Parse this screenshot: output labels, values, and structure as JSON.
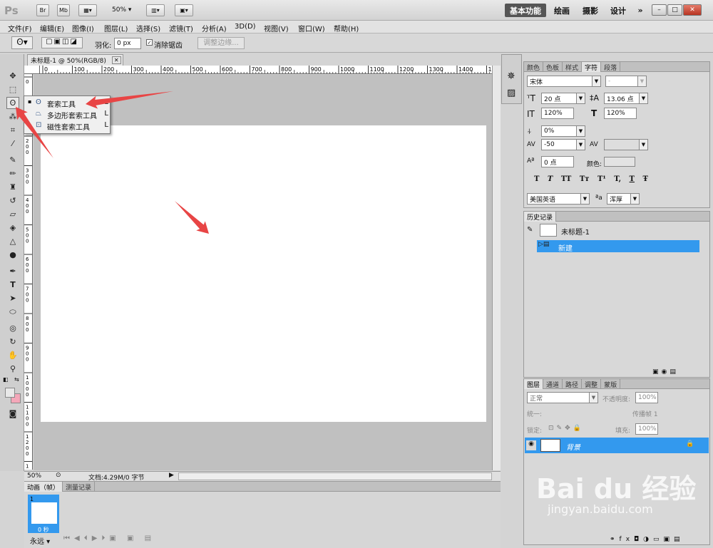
{
  "app": {
    "logo": "Ps",
    "bridge": "Br",
    "minibridge": "Mb",
    "zoom": "50%"
  },
  "workspaces": [
    "基本功能",
    "绘画",
    "摄影",
    "设计"
  ],
  "window_controls": {
    "more": "»",
    "min": "–",
    "max": "□",
    "close": "✕"
  },
  "menu": [
    "文件(F)",
    "编辑(E)",
    "图像(I)",
    "图层(L)",
    "选择(S)",
    "滤镜(T)",
    "分析(A)",
    "3D(D)",
    "视图(V)",
    "窗口(W)",
    "帮助(H)"
  ],
  "options": {
    "feather_label": "羽化:",
    "feather_value": "0 px",
    "antialias": "消除锯齿",
    "refine": "调整边缘..."
  },
  "document": {
    "tab": "未标题-1 @ 50%(RGB/8)",
    "close": "✕",
    "zoom": "50%",
    "doc_info": "文档:4.29M/0 字节"
  },
  "ruler_h": [
    "0",
    "100",
    "200",
    "300",
    "400",
    "500",
    "600",
    "700",
    "800",
    "900",
    "1000",
    "1100",
    "1200",
    "1300",
    "1400",
    "15"
  ],
  "ruler_v": [
    "0",
    "1\n0\n0",
    "2\n0\n0",
    "3\n0\n0",
    "4\n0\n0",
    "5\n0\n0",
    "6\n0\n0",
    "7\n0\n0",
    "8\n0\n0",
    "9\n0\n0",
    "1\n0\n0\n0",
    "1\n1\n0\n0",
    "1\n2\n0\n0",
    "1\n3\n0\n0"
  ],
  "context_menu": [
    {
      "label": "套索工具",
      "key": "L",
      "bullet": "▪"
    },
    {
      "label": "多边形套索工具",
      "key": "L"
    },
    {
      "label": "磁性套索工具",
      "key": "L"
    }
  ],
  "char_panel": {
    "tabs": [
      "颜色",
      "色板",
      "样式",
      "字符",
      "段落"
    ],
    "font": "宋体",
    "style": "-",
    "size": "20 点",
    "leading": "13.06 点",
    "vscale": "120%",
    "hscale": "120%",
    "baseline_pct": "0%",
    "tracking": "-50",
    "kerning": "",
    "shift": "0 点",
    "color_label": "颜色:",
    "lang": "美国英语",
    "aa_label": "ªa",
    "aa": "浑厚",
    "typo": [
      "T",
      "T",
      "TT",
      "Tт",
      "T¹",
      "T,",
      "T",
      "Ŧ"
    ]
  },
  "history": {
    "tab": "历史记录",
    "snapshot": "未标题-1",
    "state": "新建"
  },
  "layers": {
    "tabs": [
      "图层",
      "通道",
      "路径",
      "调整",
      "蒙版"
    ],
    "blend": "正常",
    "opacity_label": "不透明度:",
    "opacity": "100%",
    "unify": "统一:",
    "propagate": "传播帧 1",
    "lock_label": "锁定:",
    "fill_label": "填充:",
    "fill": "100%",
    "layer_name": "背景"
  },
  "anim": {
    "tabs": [
      "动画（帧）",
      "测量记录"
    ],
    "frame_num": "1",
    "frame_time": "0 秒",
    "loop": "永远"
  },
  "colors": {
    "fg": "#e8e8e8",
    "bg": "#f4a7b9",
    "accent": "#3399ee",
    "arrow": "#e84545"
  },
  "watermark": {
    "main": "Bai du 经验",
    "sub": "jingyan.baidu.com"
  }
}
